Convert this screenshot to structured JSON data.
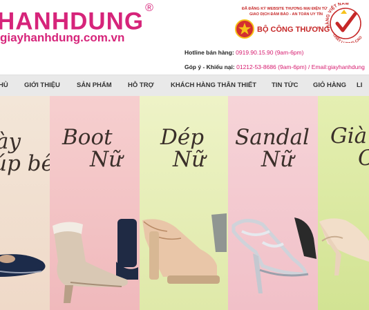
{
  "brand": {
    "logo_text": "HANHDUNG",
    "registered": "®",
    "site_url": "giayhanhdung.com.vn"
  },
  "badges": {
    "moit_line1": "ĐÃ ĐĂNG KÝ WEBSITE THƯƠNG MẠI ĐIỆN TỬ",
    "moit_line2": "GIAO DỊCH ĐẢM BẢO - AN TOÀN UY TÍN",
    "moit_name": "BỘ CÔNG THƯƠNG",
    "hvn_top": "HÀNG VIỆT NAM",
    "hvn_bottom": "CHẤT LƯỢNG CAO"
  },
  "contact": {
    "hotline_label": "Hotline bán hàng:",
    "hotline_value": "0919.90.15.90 (9am-6pm)",
    "feedback_label": "Góp ý - Khiếu nại:",
    "feedback_value": "01212-53-8686 (9am-6pm) / Email:",
    "email_value": "giayhanhdung"
  },
  "nav": {
    "items": [
      "HỦ",
      "GIỚI THIỆU",
      "SẢN PHẨM",
      "HỖ TRỢ",
      "KHÁCH HÀNG THÂN THIẾT",
      "TIN TỨC",
      "GIỎ HÀNG",
      "LI"
    ]
  },
  "banner": {
    "panels": [
      {
        "line1": "ày",
        "line2": "úp bê",
        "bg": "#f1e3d6"
      },
      {
        "line1": "Boot",
        "line2": "Nữ",
        "bg": "#f3c6c7"
      },
      {
        "line1": "Dép",
        "line2": "Nữ",
        "bg": "#e5eeb8"
      },
      {
        "line1": "Sandal",
        "line2": "Nữ",
        "bg": "#f4ccd2"
      },
      {
        "line1": "Già",
        "line2": "C",
        "bg": "#dbe99f"
      }
    ]
  },
  "colors": {
    "brand_pink": "#d6247a",
    "nav_bg": "#e9e9e9",
    "badge_red": "#c62828"
  }
}
